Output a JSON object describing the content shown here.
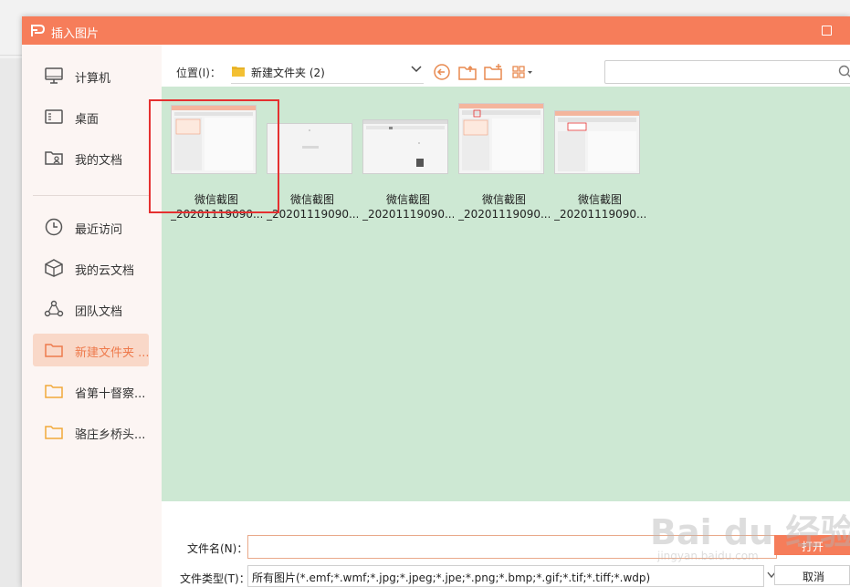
{
  "dialog": {
    "title": "插入图片",
    "accent_color": "#f67d5a"
  },
  "sidebar": {
    "items": [
      {
        "label": "计算机",
        "icon": "computer-icon"
      },
      {
        "label": "桌面",
        "icon": "desktop-icon"
      },
      {
        "label": "我的文档",
        "icon": "documents-folder-icon"
      },
      {
        "label": "最近访问",
        "icon": "clock-icon"
      },
      {
        "label": "我的云文档",
        "icon": "cloud-box-icon"
      },
      {
        "label": "团队文档",
        "icon": "team-icon"
      },
      {
        "label": "新建文件夹 ...",
        "icon": "folder-icon",
        "active": true
      },
      {
        "label": "省第十督察...",
        "icon": "folder-icon"
      },
      {
        "label": "骆庄乡桥头...",
        "icon": "folder-icon"
      }
    ]
  },
  "toolbar": {
    "location_label": "位置(I)：",
    "location_value": "新建文件夹 (2)",
    "search_placeholder": ""
  },
  "files": [
    {
      "name": "微信截图",
      "name2": "_20201119090..."
    },
    {
      "name": "微信截图",
      "name2": "_20201119090..."
    },
    {
      "name": "微信截图",
      "name2": "_20201119090..."
    },
    {
      "name": "微信截图",
      "name2": "_20201119090..."
    },
    {
      "name": "微信截图",
      "name2": "_20201119090..."
    }
  ],
  "footer": {
    "filename_label": "文件名(N)：",
    "filename_value": "",
    "filetype_label": "文件类型(T)：",
    "filetype_value": "所有图片(*.emf;*.wmf;*.jpg;*.jpeg;*.jpe;*.png;*.bmp;*.gif;*.tif;*.tiff;*.wdp)",
    "open_label": "打开",
    "cancel_label": "取消"
  },
  "watermark": {
    "line1": "Bai du 经验",
    "line2": "jingyan.baidu.com"
  }
}
